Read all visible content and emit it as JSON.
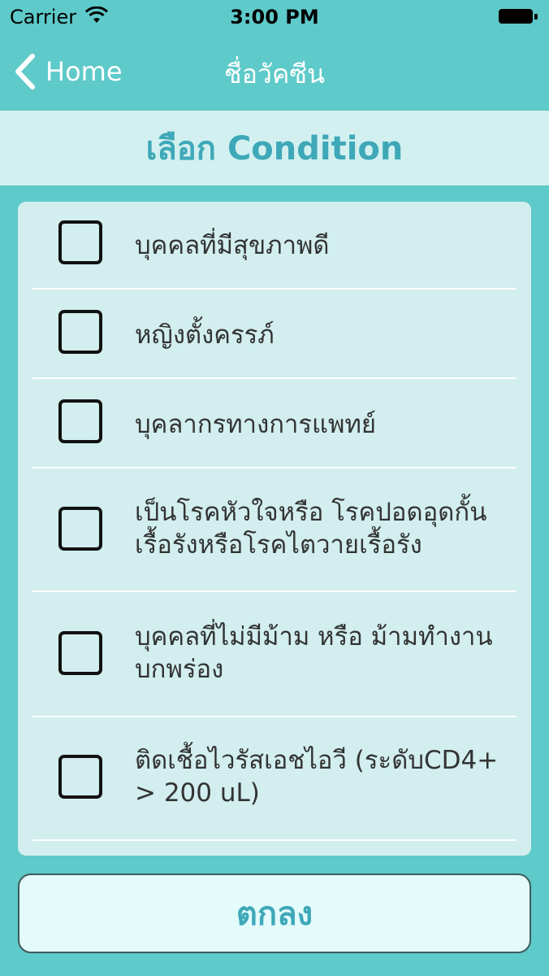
{
  "status_bar": {
    "carrier": "Carrier",
    "time": "3:00 PM"
  },
  "nav": {
    "back_label": "Home",
    "title": "ชื่อวัคซีน"
  },
  "section": {
    "title": "เลือก  Condition"
  },
  "conditions": [
    {
      "label": "บุคคลที่มีสุขภาพดี",
      "checked": false
    },
    {
      "label": "หญิงตั้งครรภ์",
      "checked": false
    },
    {
      "label": "บุคลากรทางการแพทย์",
      "checked": false
    },
    {
      "label": "เป็นโรคหัวใจหรือ  โรคปอดอุดกั้นเรื้อรังหรือโรคไตวายเรื้อรัง",
      "checked": false
    },
    {
      "label": "บุคคลที่ไม่มีม้าม  หรือ  ม้ามทำงานบกพร่อง",
      "checked": false
    },
    {
      "label": "ติดเชื้อไวรัสเอชไอวี  (ระดับCD4+ > 200  uL)",
      "checked": false
    }
  ],
  "confirm": {
    "label": "ตกลง"
  }
}
